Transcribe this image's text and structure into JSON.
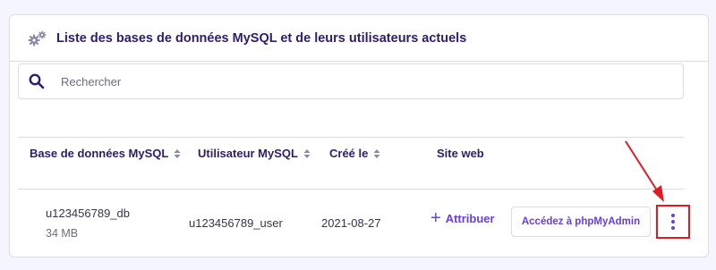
{
  "header": {
    "title": "Liste des bases de données MySQL et de leurs utilisateurs actuels",
    "icon": "gear-icon"
  },
  "search": {
    "placeholder": "Rechercher",
    "value": ""
  },
  "table": {
    "columns": [
      "Base de données MySQL",
      "Utilisateur MySQL",
      "Créé le",
      "Site web"
    ],
    "rows": [
      {
        "database": "u123456789_db",
        "size": "34 MB",
        "user": "u123456789_user",
        "created": "2021-08-27",
        "website_action": "Attribuer",
        "phpmyadmin_label": "Accédez à phpMyAdmin"
      }
    ]
  },
  "colors": {
    "accent": "#673de6",
    "highlight": "#e01b22",
    "title": "#2f1c6a"
  }
}
